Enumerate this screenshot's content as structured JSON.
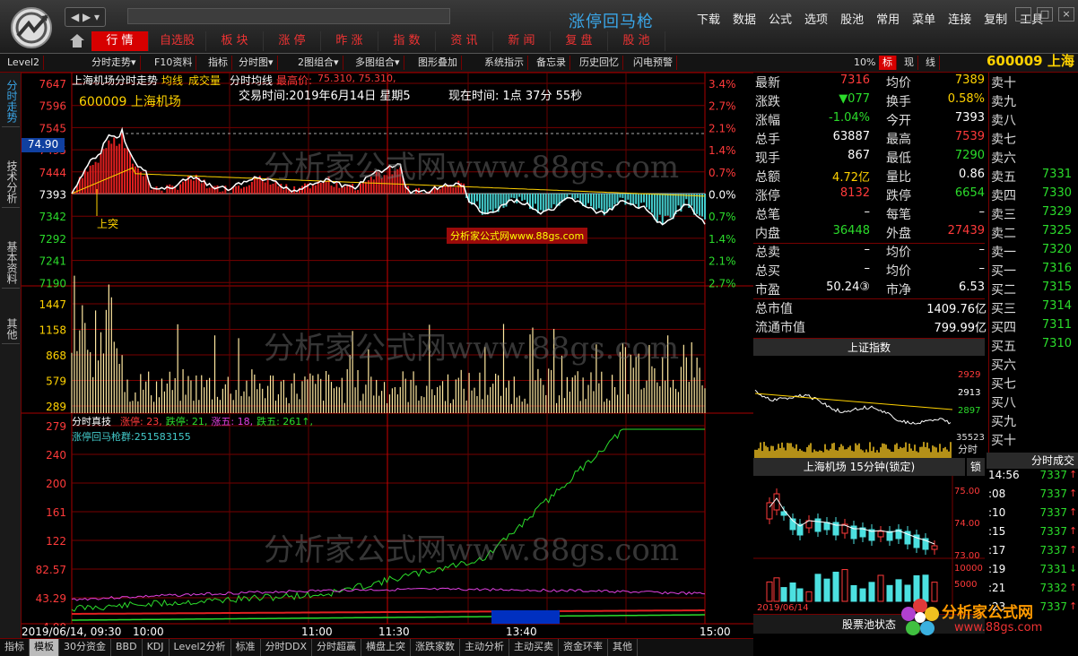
{
  "app": {
    "title": "涨停回马枪",
    "nav": "◀ ▶ ▾"
  },
  "menu": [
    "下载",
    "数据",
    "公式",
    "选项",
    "股池",
    "常用",
    "菜单",
    "连接",
    "复制",
    "工具"
  ],
  "window_controls": [
    "_",
    "□",
    "×"
  ],
  "main_tabs": [
    {
      "label": "行 情",
      "active": true
    },
    {
      "label": "自选股"
    },
    {
      "label": "板 块"
    },
    {
      "label": "涨 停"
    },
    {
      "label": "昨 涨"
    },
    {
      "label": "指 数"
    },
    {
      "label": "资 讯"
    },
    {
      "label": "新 闻"
    },
    {
      "label": "复 盘"
    },
    {
      "label": "股 池"
    }
  ],
  "toolbar": [
    "Level2",
    "分时走势▾",
    "F10资料",
    "指标",
    "分时图▾",
    "2图组合▾",
    "多图组合▾",
    "图形叠加",
    "系统指示",
    "备忘录",
    "历史回忆",
    "闪电预警"
  ],
  "toolbar_right": {
    "zoom": "10%",
    "tabs": [
      "标",
      "现",
      "线"
    ],
    "code": "600009 上海"
  },
  "left_tabs": [
    "分时走势",
    "技术分析",
    "基本资料",
    "其他"
  ],
  "chart": {
    "header": "上海机场分时走势",
    "legend": [
      "均线",
      "成交量",
      "分时均线"
    ],
    "high_label": "最高价:",
    "high_value": "75.310, 75.310,",
    "stock_name": "600009  上海机场",
    "trade_time": "交易时间:2019年6月14日 星期5",
    "now_time": "现在时间: 1点  37分  55秒",
    "cursor_price": "74.90",
    "price_ticks": [
      "7647",
      "7596",
      "7545",
      "7495",
      "7444",
      "7393",
      "7342",
      "7292",
      "7241",
      "7190"
    ],
    "pct_ticks": [
      "3.4%",
      "2.7%",
      "2.1%",
      "1.4%",
      "0.7%",
      "0.0%",
      "0.7%",
      "1.4%",
      "2.1%",
      "2.7%"
    ],
    "vol_ticks": [
      "1447",
      "1158",
      "868",
      "579",
      "289"
    ],
    "mark_label": "上突",
    "watermark": "分析家公式网www.88gs.com",
    "watermark_small": "分析家公式网www.88gs.com",
    "indicator_title": "分时真技",
    "indicator_stats": [
      {
        "text": "涨停: 23,",
        "color": "#ff3a3a"
      },
      {
        "text": "跌停: 21,",
        "color": "#2bdc2b"
      },
      {
        "text": "涨五: 18,",
        "color": "#e040e0"
      },
      {
        "text": "跌五: 261↑,",
        "color": "#2bdc2b"
      }
    ],
    "indicator_sub": "涨停回马枪群:251583155",
    "ind_ticks": [
      "279",
      "240",
      "200",
      "161",
      "122",
      "82.57",
      "43.29",
      "4.00"
    ],
    "time_axis": [
      "2019/06/14, 09:30",
      "10:00",
      "11:00",
      "11:30",
      "13:40",
      "15:00"
    ]
  },
  "quote": {
    "left": [
      [
        "最新",
        "7316",
        "red"
      ],
      [
        "涨跌",
        "▼077",
        "grn"
      ],
      [
        "涨幅",
        "-1.04%",
        "grn"
      ],
      [
        "总手",
        "63887",
        "wht"
      ],
      [
        "现手",
        "867",
        "wht"
      ],
      [
        "总额",
        "4.72亿",
        "yel"
      ],
      [
        "涨停",
        "8132",
        "red"
      ],
      [
        "总笔",
        "–",
        "wht"
      ],
      [
        "内盘",
        "36448",
        "grn"
      ],
      [
        "总卖",
        "–",
        "wht"
      ],
      [
        "总买",
        "–",
        "wht"
      ],
      [
        "市盈",
        "50.24③",
        "wht"
      ],
      [
        "总市值",
        "1409.76亿",
        "wht"
      ],
      [
        "流通市值",
        "799.99亿",
        "wht"
      ]
    ],
    "right": [
      [
        "均价",
        "7389",
        "yel"
      ],
      [
        "换手",
        "0.58%",
        "yel"
      ],
      [
        "今开",
        "7393",
        "wht"
      ],
      [
        "最高",
        "7539",
        "red"
      ],
      [
        "最低",
        "7290",
        "grn"
      ],
      [
        "量比",
        "0.86",
        "wht"
      ],
      [
        "跌停",
        "6654",
        "grn"
      ],
      [
        "每笔",
        "–",
        "wht"
      ],
      [
        "外盘",
        "27439",
        "red"
      ],
      [
        "均价",
        "–",
        "wht"
      ],
      [
        "均价",
        "–",
        "wht"
      ],
      [
        "市净",
        "6.53",
        "wht"
      ]
    ]
  },
  "orderbook": [
    [
      "卖十",
      ""
    ],
    [
      "卖九",
      ""
    ],
    [
      "卖八",
      ""
    ],
    [
      "卖七",
      ""
    ],
    [
      "卖六",
      ""
    ],
    [
      "卖五",
      "7331"
    ],
    [
      "卖四",
      "7330"
    ],
    [
      "卖三",
      "7329"
    ],
    [
      "卖二",
      "7325"
    ],
    [
      "卖一",
      "7320"
    ],
    [
      "买一",
      "7316"
    ],
    [
      "买二",
      "7315"
    ],
    [
      "买三",
      "7314"
    ],
    [
      "买四",
      "7311"
    ],
    [
      "买五",
      "7310"
    ],
    [
      "买六",
      ""
    ],
    [
      "买七",
      ""
    ],
    [
      "买八",
      ""
    ],
    [
      "买九",
      ""
    ],
    [
      "买十",
      ""
    ]
  ],
  "index_panel": {
    "title": "上证指数",
    "ticks": [
      "2929",
      "2913",
      "2897"
    ],
    "vol": "35523",
    "label": "分时"
  },
  "kline_panel": {
    "title": "上海机场 15分钟(锁定)",
    "lock": "锁",
    "ticks": [
      "75.00",
      "74.00",
      "73.00"
    ],
    "vol_ticks": [
      "10000",
      "5000"
    ],
    "date": "2019/06/14"
  },
  "pool_status": "股票池状态",
  "ticks_panel": {
    "title": "分时成交",
    "rows": [
      [
        "14:56",
        "7337"
      ],
      [
        ":08",
        "7337"
      ],
      [
        ":10",
        "7337"
      ],
      [
        ":15",
        "7337"
      ],
      [
        ":17",
        "7337"
      ],
      [
        ":19",
        "7331"
      ],
      [
        ":21",
        "7332"
      ],
      [
        ":23",
        "7337"
      ]
    ]
  },
  "brand": {
    "name": "分析家公式网",
    "url": "www.88gs.com"
  },
  "bottom_tabs": [
    {
      "label": "指标"
    },
    {
      "label": "模板",
      "active": true
    },
    {
      "label": "30分资金"
    },
    {
      "label": "BBD"
    },
    {
      "label": "KDJ"
    },
    {
      "label": "Level2分析"
    },
    {
      "label": "标准"
    },
    {
      "label": "分时DDX"
    },
    {
      "label": "分时超赢"
    },
    {
      "label": "横盘上突"
    },
    {
      "label": "涨跌家数"
    },
    {
      "label": "主动分析"
    },
    {
      "label": "主动买卖"
    },
    {
      "label": "资金环率"
    },
    {
      "label": "其他"
    }
  ]
}
